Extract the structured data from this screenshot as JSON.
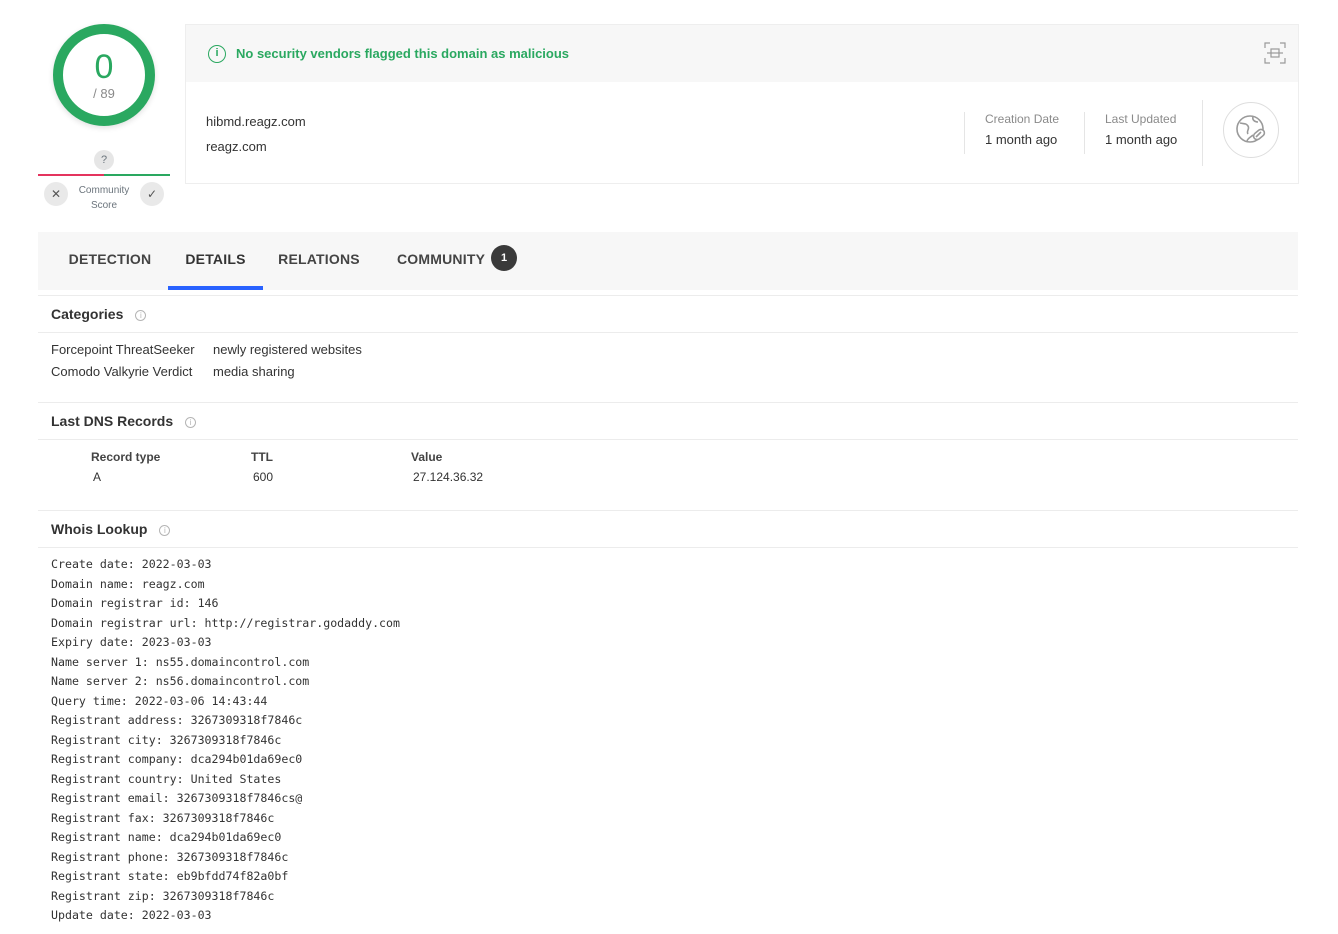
{
  "score": {
    "detections": "0",
    "total": "/ 89"
  },
  "community_score": {
    "value": "?",
    "label_line1": "Community",
    "label_line2": "Score",
    "downvote_icon": "✕",
    "upvote_icon": "✓"
  },
  "status": {
    "message": "No security vendors flagged this domain as malicious",
    "color": "#2aa860"
  },
  "domain": {
    "name": "hibmd.reagz.com",
    "parent": "reagz.com",
    "creation_label": "Creation Date",
    "creation_value": "1 month ago",
    "updated_label": "Last Updated",
    "updated_value": "1 month ago"
  },
  "tabs": [
    {
      "label": "DETECTION"
    },
    {
      "label": "DETAILS",
      "active": true
    },
    {
      "label": "RELATIONS"
    },
    {
      "label": "COMMUNITY",
      "badge": "1"
    }
  ],
  "categories": {
    "title": "Categories",
    "items": [
      {
        "source": "Forcepoint ThreatSeeker",
        "value": "newly registered websites"
      },
      {
        "source": "Comodo Valkyrie Verdict",
        "value": "media sharing"
      }
    ]
  },
  "dns": {
    "title": "Last DNS Records",
    "headers": [
      "Record type",
      "TTL",
      "Value"
    ],
    "rows": [
      [
        "A",
        "600",
        "27.124.36.32"
      ]
    ]
  },
  "whois": {
    "title": "Whois Lookup",
    "lines": [
      "Create date: 2022-03-03",
      "Domain name: reagz.com",
      "Domain registrar id: 146",
      "Domain registrar url: http://registrar.godaddy.com",
      "Expiry date: 2023-03-03",
      "Name server 1: ns55.domaincontrol.com",
      "Name server 2: ns56.domaincontrol.com",
      "Query time: 2022-03-06 14:43:44",
      "Registrant address: 3267309318f7846c",
      "Registrant city: 3267309318f7846c",
      "Registrant company: dca294b01da69ec0",
      "Registrant country: United States",
      "Registrant email: 3267309318f7846cs@",
      "Registrant fax: 3267309318f7846c",
      "Registrant name: dca294b01da69ec0",
      "Registrant phone: 3267309318f7846c",
      "Registrant state: eb9bfdd74f82a0bf",
      "Registrant zip: 3267309318f7846c",
      "Update date: 2022-03-03"
    ]
  },
  "icons": {
    "info": "info-circle-icon",
    "qr": "qr-scan-icon",
    "globe": "globe-link-icon",
    "help": "help-circle-icon"
  }
}
